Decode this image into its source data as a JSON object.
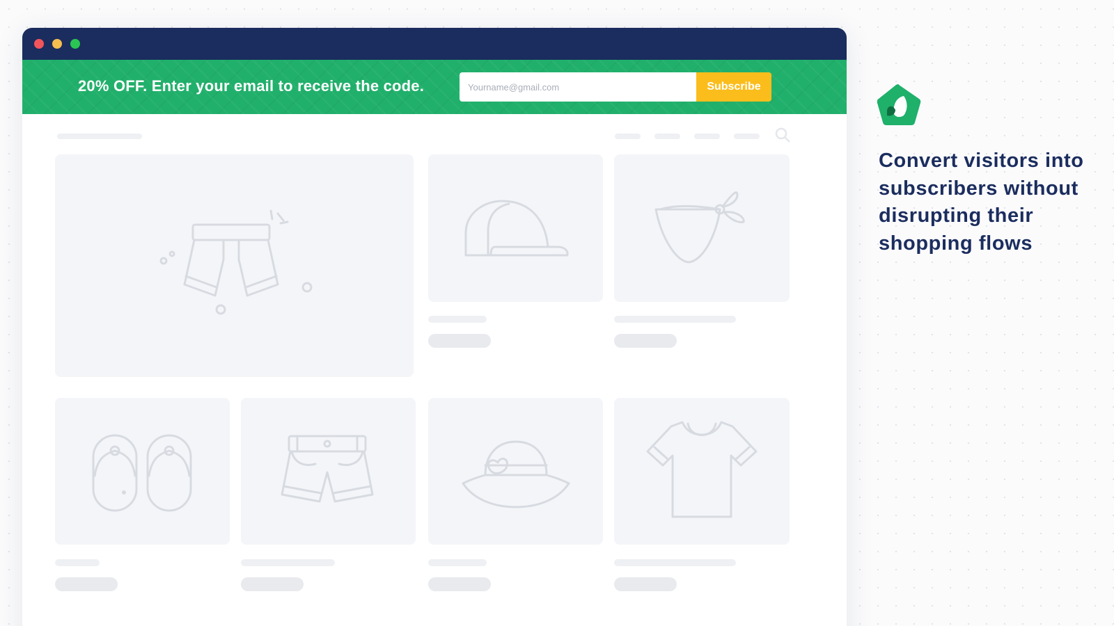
{
  "window": {
    "traffic_lights": [
      "close",
      "minimize",
      "maximize"
    ]
  },
  "promo_bar": {
    "text": "20% OFF. Enter your email to receive the code.",
    "email_placeholder": "Yourname@gmail.com",
    "subscribe_label": "Subscribe",
    "colors": {
      "banner": "#21b06b",
      "button": "#fbbd1c",
      "titlebar": "#1b2d5e"
    }
  },
  "store": {
    "search_icon": "search-icon",
    "products": [
      {
        "icon": "boxer-shorts-icon"
      },
      {
        "icon": "cap-icon"
      },
      {
        "icon": "bandana-icon"
      },
      {
        "icon": "flip-flops-icon"
      },
      {
        "icon": "shorts-icon"
      },
      {
        "icon": "bucket-hat-icon"
      },
      {
        "icon": "t-shirt-icon"
      }
    ]
  },
  "side_panel": {
    "logo": "leaf-pentagon-logo",
    "tagline": "Convert visitors into subscribers without disrupting their shopping flows"
  }
}
